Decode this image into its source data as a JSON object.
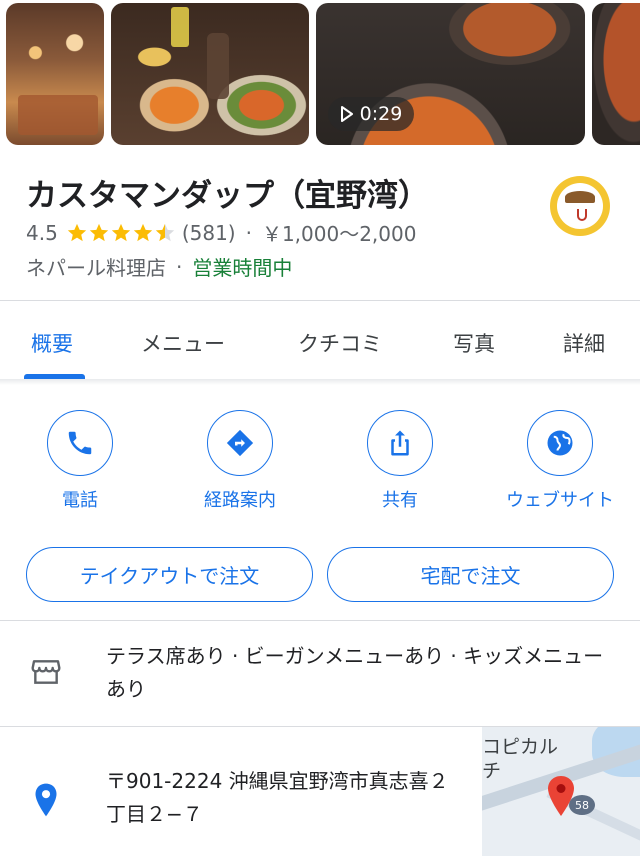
{
  "photos": {
    "video_duration": "0:29"
  },
  "place": {
    "name": "カスタマンダップ（宜野湾）",
    "rating": "4.5",
    "stars": 4.5,
    "review_count": "(581)",
    "price_range": "￥1,000～2,000",
    "category": "ネパール料理店",
    "open_status": "営業時間中",
    "separator": "·"
  },
  "tabs": [
    {
      "label": "概要",
      "active": true
    },
    {
      "label": "メニュー",
      "active": false
    },
    {
      "label": "クチコミ",
      "active": false
    },
    {
      "label": "写真",
      "active": false
    },
    {
      "label": "詳細",
      "active": false
    }
  ],
  "actions": [
    {
      "label": "電話",
      "icon": "phone-icon"
    },
    {
      "label": "経路案内",
      "icon": "directions-icon"
    },
    {
      "label": "共有",
      "icon": "share-icon"
    },
    {
      "label": "ウェブサイト",
      "icon": "globe-icon"
    }
  ],
  "order_buttons": {
    "takeout": "テイクアウトで注文",
    "delivery": "宅配で注文"
  },
  "amenities": {
    "text": "テラス席あり · ビーガンメニューあり · キッズメニューあり",
    "icon": "storefront-icon"
  },
  "address": {
    "text": "〒901-2224 沖縄県宜野湾市真志喜２丁目２−７",
    "icon": "location-pin-icon"
  },
  "map": {
    "label_line1": "コピカル",
    "label_line2": "チ",
    "route_number": "58"
  },
  "colors": {
    "accent": "#1a73e8",
    "star": "#fbbc04",
    "open": "#188038",
    "pin": "#ea4335"
  }
}
